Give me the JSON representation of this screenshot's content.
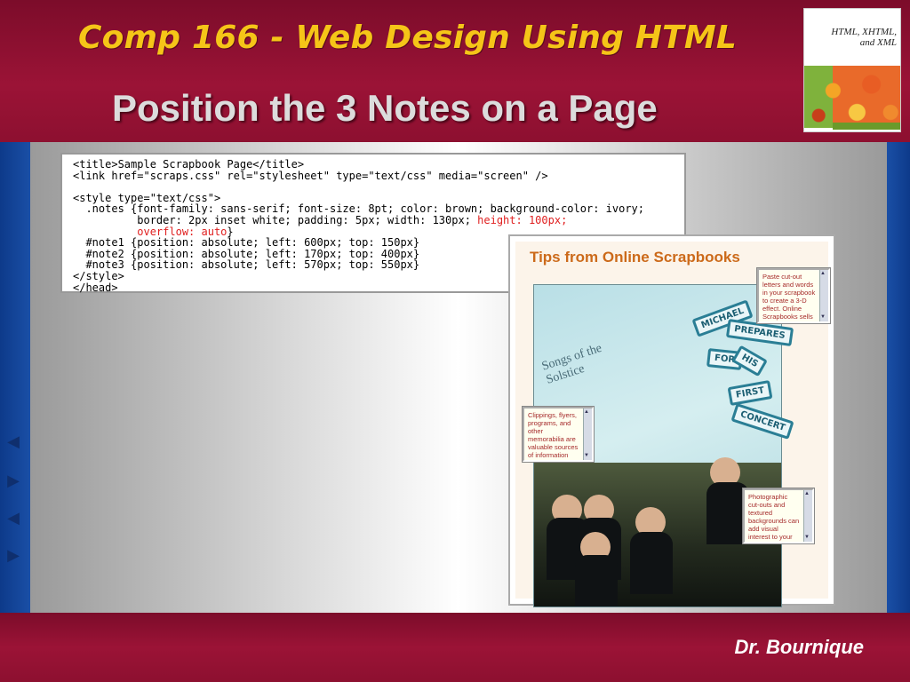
{
  "header": {
    "course_title": "Comp 166 - Web Design Using HTML",
    "slide_title": "Position the 3 Notes on a Page"
  },
  "book_cover": {
    "title": "HTML, XHTML, and XML"
  },
  "code": {
    "line1": "<title>Sample Scrapbook Page</title>",
    "line2": "<link href=\"scraps.css\" rel=\"stylesheet\" type=\"text/css\" media=\"screen\" />",
    "line3": "",
    "line4": "<style type=\"text/css\">",
    "line5": "  .notes {font-family: sans-serif; font-size: 8pt; color: brown; background-color: ivory;",
    "line6a": "          border: 2px inset white; padding: 5px; width: 130px; ",
    "line6b": "height: 100px;",
    "line7a": "          ",
    "line7b": "overflow: auto",
    "line7c": "}",
    "line8": "  #note1 {position: absolute; left: 600px; top: 150px}",
    "line9": "  #note2 {position: absolute; left: 170px; top: 400px}",
    "line10": "  #note3 {position: absolute; left: 570px; top: 550px}",
    "line11": "</style>",
    "line12": "</head>"
  },
  "browser": {
    "tips_title": "Tips from Online Scrapbooks",
    "note1": "Paste cut-out letters and words in your scrapbook to create a 3-D effect. Online Scrapbooks sells professionally designed cut-out",
    "note2": "Clippings, flyers, programs, and other memorabilia are valuable sources of information that can enhance your scrapbook pages.",
    "note3": "Photographic cut-outs and textured backgrounds can add visual interest to your pages. See the online store for the wide variety of",
    "scrapbook_heading": "Songs of the Solstice",
    "tags": [
      "MICHAEL",
      "PREPARES",
      "FOR",
      "HIS",
      "FIRST",
      "CONCERT"
    ]
  },
  "footer": {
    "author": "Dr. Bournique"
  },
  "colors": {
    "header_bg": "#8d1030",
    "course_title": "#f5c518",
    "slide_title": "#dcdcdc",
    "side_blue": "#1a4fa6",
    "note_text": "#a52a2a",
    "code_highlight": "#e02020"
  }
}
